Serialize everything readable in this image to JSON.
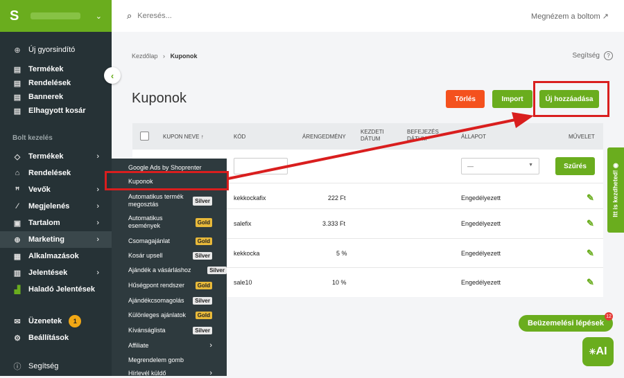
{
  "search": {
    "placeholder": "Keresés..."
  },
  "header": {
    "view_store": "Megnézem a boltom"
  },
  "sidebar": {
    "quick": "Új gyorsindító",
    "top_items": [
      {
        "label": "Termékek"
      },
      {
        "label": "Rendelések"
      },
      {
        "label": "Bannerek"
      },
      {
        "label": "Elhagyott kosár"
      }
    ],
    "section_title": "Bolt kezelés",
    "menu": [
      {
        "label": "Termékek"
      },
      {
        "label": "Rendelések"
      },
      {
        "label": "Vevők"
      },
      {
        "label": "Megjelenés"
      },
      {
        "label": "Tartalom"
      },
      {
        "label": "Marketing"
      },
      {
        "label": "Alkalmazások"
      },
      {
        "label": "Jelentések"
      },
      {
        "label": "Haladó Jelentések"
      }
    ],
    "messages": "Üzenetek",
    "messages_count": "1",
    "settings": "Beállítások",
    "help": "Segítség"
  },
  "breadcrumb": {
    "home": "Kezdőlap",
    "current": "Kuponok"
  },
  "help_link": "Segítség",
  "page_title": "Kuponok",
  "buttons": {
    "delete": "Törlés",
    "import": "Import",
    "add_new": "Új hozzáadása",
    "filter": "Szűrés"
  },
  "colors": {
    "brand": "#6aad1e",
    "danger": "#f4511e",
    "highlight": "#d91e1e",
    "gold": "#e8b93a"
  },
  "table": {
    "columns": {
      "name": "KUPON NEVE",
      "code": "KÓD",
      "discount": "ÁRENGEDMÉNY",
      "start": "KEZDETI DÁTUM",
      "end": "BEFEJEZÉS DÁTUM",
      "status": "ÁLLAPOT",
      "action": "MŰVELET"
    },
    "status_filter": "—",
    "rows": [
      {
        "code": "kekkockafix",
        "discount": "222 Ft",
        "status": "Engedélyezett"
      },
      {
        "code": "salefix",
        "discount": "3.333 Ft",
        "status": "Engedélyezett"
      },
      {
        "code": "kekkocka",
        "discount": "5 %",
        "status": "Engedélyezett"
      },
      {
        "code": "sale10",
        "discount": "10 %",
        "status": "Engedélyezett"
      }
    ]
  },
  "submenu": [
    {
      "label": "Google Ads by Shoprenter",
      "tier": ""
    },
    {
      "label": "Kuponok",
      "tier": ""
    },
    {
      "label": "Automatikus termék megosztás",
      "tier": "Silver"
    },
    {
      "label": "Automatikus események",
      "tier": "Gold"
    },
    {
      "label": "Csomagajánlat",
      "tier": "Gold"
    },
    {
      "label": "Kosár upsell",
      "tier": "Silver"
    },
    {
      "label": "Ajándék a vásárláshoz",
      "tier": "Silver"
    },
    {
      "label": "Hűségpont rendszer",
      "tier": "Gold"
    },
    {
      "label": "Ajándékcsomagolás",
      "tier": "Silver"
    },
    {
      "label": "Különleges ajánlatok",
      "tier": "Gold"
    },
    {
      "label": "Kívánságlista",
      "tier": "Silver"
    },
    {
      "label": "Affiliate",
      "tier": ""
    },
    {
      "label": "Megrendelem gomb",
      "tier": ""
    },
    {
      "label": "Hírlevél küldő",
      "tier": ""
    }
  ],
  "side_tab": "Itt is kezdheted!",
  "setup_steps": {
    "label": "Beüzemelési lépések",
    "count": "12"
  },
  "ai_button": "AI"
}
